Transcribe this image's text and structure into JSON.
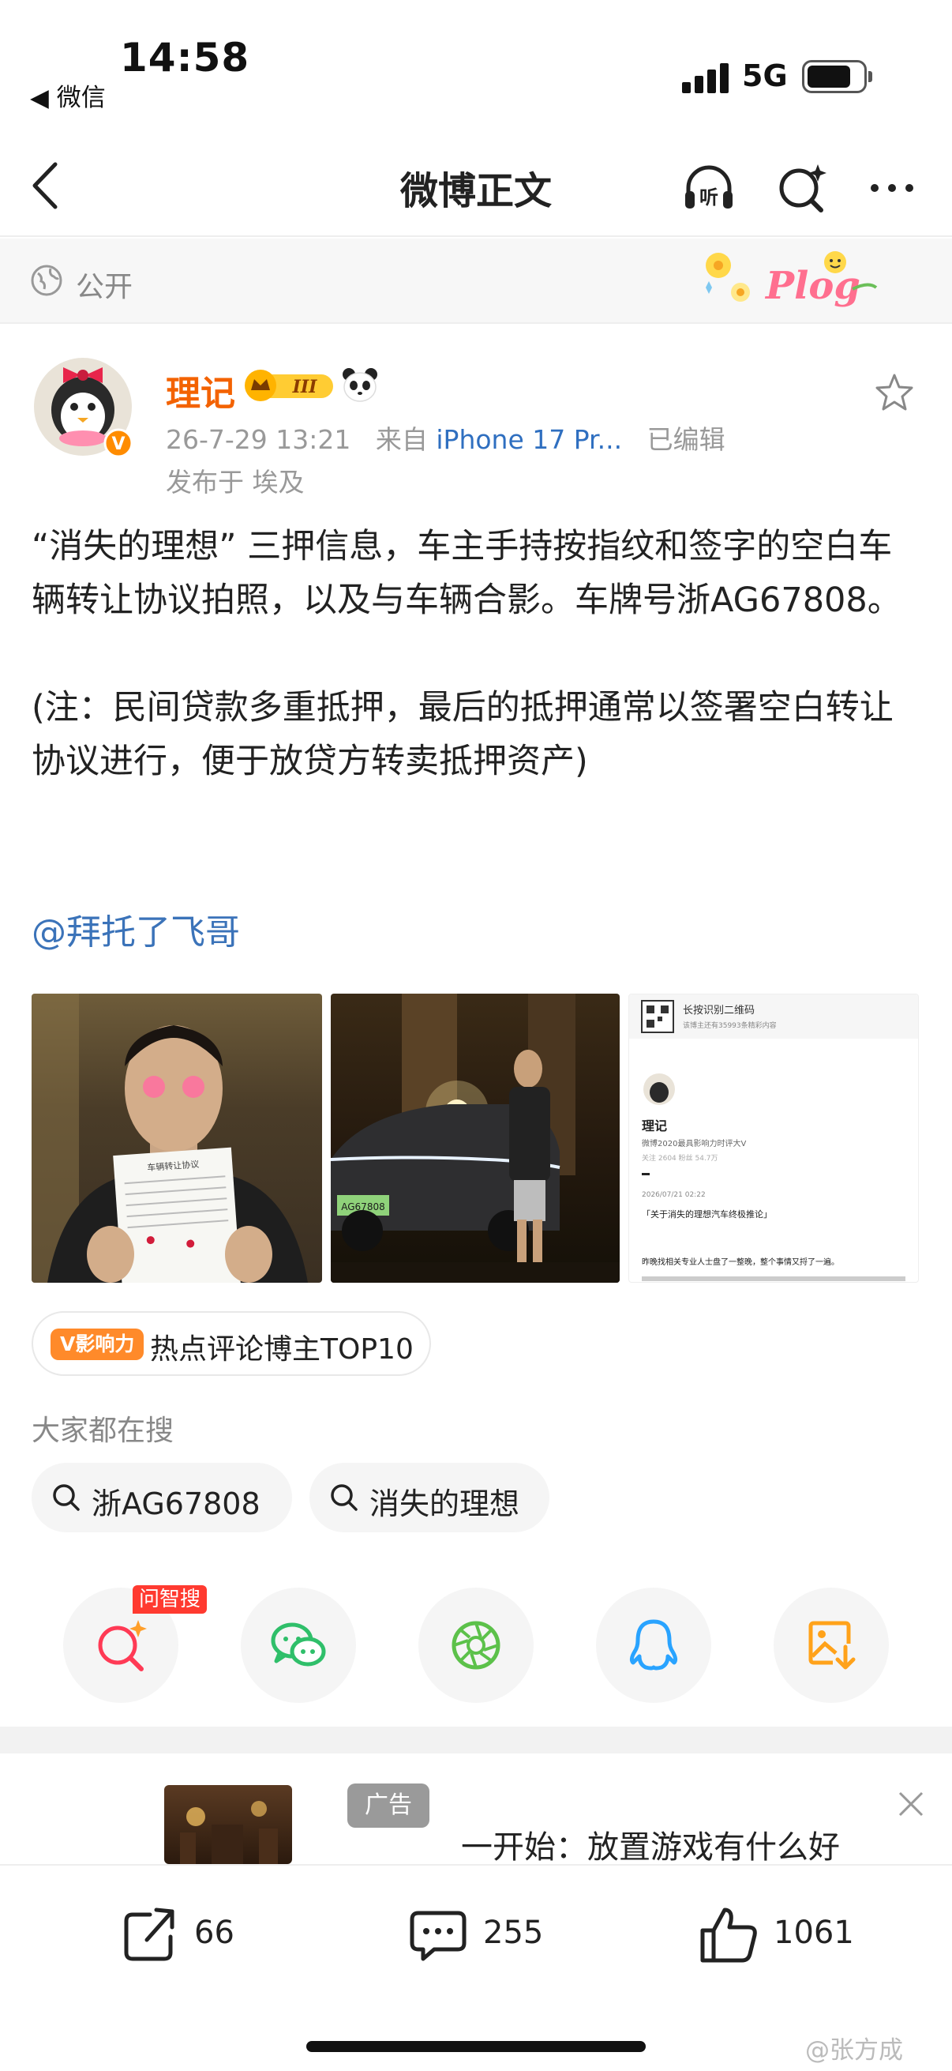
{
  "status_bar": {
    "time": "14:58",
    "back_app": "◀ 微信",
    "network": "5G"
  },
  "nav": {
    "title": "微博正文",
    "listen_icon": "headphones-listen-icon",
    "ai_search_icon": "ai-search-icon",
    "more_icon": "more-dots-icon"
  },
  "visibility": {
    "label": "公开"
  },
  "post": {
    "author": "理记",
    "vip_level": "III",
    "meta_time": "26-7-29 13:21",
    "meta_from": "来自",
    "meta_source": "iPhone 17 Pr...",
    "meta_edited": "已编辑",
    "location": "发布于 埃及",
    "paragraphs": [
      "“消失的理想” 三押信息，车主手持按指纹和签字的空白车辆转让协议拍照，以及与车辆合影。车牌号浙AG67808。",
      "(注：民间贷款多重抵押，最后的抵押通常以签署空白转让协议进行，便于放贷方转卖抵押资产)"
    ],
    "mention": "@拜托了飞哥"
  },
  "photos": {
    "photo1_doc_title": "车辆转让协议",
    "photo2_plate": "AG67808",
    "photo3": {
      "qr_title": "长按识别二维码",
      "qr_sub": "该博主还有35993条精彩内容",
      "name": "理记",
      "desc": "微博2020最具影响力时评大V",
      "stats": "关注 2604   粉丝 54.7万",
      "date": "2026/07/21 02:22",
      "headline": "「关于消失的理想汽车终极推论」",
      "body": "昨晚找相关专业人士盘了一整晚，整个事情又捋了一遍。"
    }
  },
  "influence": {
    "tag": "V影响力",
    "text": "热点评论博主TOP10"
  },
  "search": {
    "title": "大家都在搜",
    "chips": [
      "浙AG67808",
      "消失的理想"
    ]
  },
  "share": {
    "hot_tag": "问智搜",
    "buttons": [
      "ai-search-icon",
      "wechat-icon",
      "moments-icon",
      "qq-icon",
      "save-image-icon"
    ]
  },
  "ad": {
    "tag": "广告",
    "title": "一开始：放置游戏有什么好"
  },
  "actions": {
    "repost": "66",
    "comment": "255",
    "like": "1061"
  },
  "watermark": "@张方成",
  "colors": {
    "author": "#f36200",
    "link": "#3b73b9",
    "source": "#2f6fc0",
    "hot": "#ff3a30",
    "influence": "#ff8a2a"
  }
}
